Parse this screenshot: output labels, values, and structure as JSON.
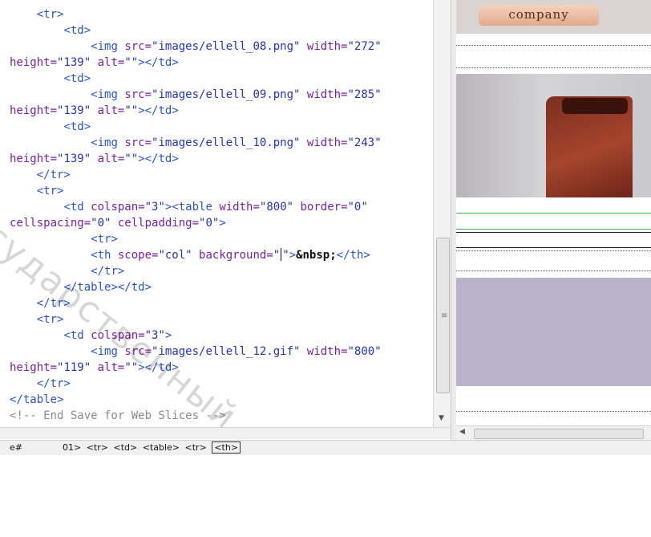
{
  "code_lines": [
    {
      "indent": "    ",
      "parts": [
        {
          "t": "<tr>",
          "c": "tag"
        }
      ]
    },
    {
      "indent": "        ",
      "parts": [
        {
          "t": "<td>",
          "c": "tag"
        }
      ]
    },
    {
      "indent": "            ",
      "parts": [
        {
          "t": "<img ",
          "c": "tag"
        },
        {
          "t": "src=",
          "c": "attr"
        },
        {
          "t": "\"images/ellell_08.png\"",
          "c": "str"
        },
        {
          "t": " width=",
          "c": "attr"
        },
        {
          "t": "\"272\"",
          "c": "str"
        }
      ]
    },
    {
      "indent": "",
      "parts": [
        {
          "t": "height=",
          "c": "attr"
        },
        {
          "t": "\"139\"",
          "c": "str"
        },
        {
          "t": " alt=",
          "c": "attr"
        },
        {
          "t": "\"\"",
          "c": "str"
        },
        {
          "t": "></td>",
          "c": "tag"
        }
      ]
    },
    {
      "indent": "        ",
      "parts": [
        {
          "t": "<td>",
          "c": "tag"
        }
      ]
    },
    {
      "indent": "            ",
      "parts": [
        {
          "t": "<img ",
          "c": "tag"
        },
        {
          "t": "src=",
          "c": "attr"
        },
        {
          "t": "\"images/ellell_09.png\"",
          "c": "str"
        },
        {
          "t": " width=",
          "c": "attr"
        },
        {
          "t": "\"285\"",
          "c": "str"
        }
      ]
    },
    {
      "indent": "",
      "parts": [
        {
          "t": "height=",
          "c": "attr"
        },
        {
          "t": "\"139\"",
          "c": "str"
        },
        {
          "t": " alt=",
          "c": "attr"
        },
        {
          "t": "\"\"",
          "c": "str"
        },
        {
          "t": "></td>",
          "c": "tag"
        }
      ]
    },
    {
      "indent": "        ",
      "parts": [
        {
          "t": "<td>",
          "c": "tag"
        }
      ]
    },
    {
      "indent": "            ",
      "parts": [
        {
          "t": "<img ",
          "c": "tag"
        },
        {
          "t": "src=",
          "c": "attr"
        },
        {
          "t": "\"images/ellell_10.png\"",
          "c": "str"
        },
        {
          "t": " width=",
          "c": "attr"
        },
        {
          "t": "\"243\"",
          "c": "str"
        }
      ]
    },
    {
      "indent": "",
      "parts": [
        {
          "t": "height=",
          "c": "attr"
        },
        {
          "t": "\"139\"",
          "c": "str"
        },
        {
          "t": " alt=",
          "c": "attr"
        },
        {
          "t": "\"\"",
          "c": "str"
        },
        {
          "t": "></td>",
          "c": "tag"
        }
      ]
    },
    {
      "indent": "    ",
      "parts": [
        {
          "t": "</tr>",
          "c": "tag"
        }
      ]
    },
    {
      "indent": "    ",
      "parts": [
        {
          "t": "<tr>",
          "c": "tag"
        }
      ]
    },
    {
      "indent": "        ",
      "parts": [
        {
          "t": "<td ",
          "c": "tag"
        },
        {
          "t": "colspan=",
          "c": "attr"
        },
        {
          "t": "\"3\"",
          "c": "str"
        },
        {
          "t": "><table ",
          "c": "tag"
        },
        {
          "t": "width=",
          "c": "attr"
        },
        {
          "t": "\"800\"",
          "c": "str"
        },
        {
          "t": " border=",
          "c": "attr"
        },
        {
          "t": "\"0\"",
          "c": "str"
        }
      ]
    },
    {
      "indent": "",
      "parts": [
        {
          "t": "cellspacing=",
          "c": "attr"
        },
        {
          "t": "\"0\"",
          "c": "str"
        },
        {
          "t": " cellpadding=",
          "c": "attr"
        },
        {
          "t": "\"0\"",
          "c": "str"
        },
        {
          "t": ">",
          "c": "tag"
        }
      ]
    },
    {
      "indent": "            ",
      "parts": [
        {
          "t": "<tr>",
          "c": "tag"
        }
      ]
    },
    {
      "indent": "            ",
      "parts": [
        {
          "t": "<th ",
          "c": "tag"
        },
        {
          "t": "scope=",
          "c": "attr"
        },
        {
          "t": "\"col\"",
          "c": "str"
        },
        {
          "t": " background=",
          "c": "attr"
        },
        {
          "t": "\"",
          "c": "str"
        },
        {
          "t": "",
          "c": "caret"
        },
        {
          "t": "\"",
          "c": "str"
        },
        {
          "t": ">",
          "c": "tag"
        },
        {
          "t": "&nbsp;",
          "c": "txt"
        },
        {
          "t": "</th>",
          "c": "tag"
        }
      ]
    },
    {
      "indent": "            ",
      "parts": [
        {
          "t": "</tr>",
          "c": "tag"
        }
      ]
    },
    {
      "indent": "        ",
      "parts": [
        {
          "t": "</table></td>",
          "c": "tag"
        }
      ]
    },
    {
      "indent": "    ",
      "parts": [
        {
          "t": "</tr>",
          "c": "tag"
        }
      ]
    },
    {
      "indent": "    ",
      "parts": [
        {
          "t": "<tr>",
          "c": "tag"
        }
      ]
    },
    {
      "indent": "        ",
      "parts": [
        {
          "t": "<td ",
          "c": "tag"
        },
        {
          "t": "colspan=",
          "c": "attr"
        },
        {
          "t": "\"3\"",
          "c": "str"
        },
        {
          "t": ">",
          "c": "tag"
        }
      ]
    },
    {
      "indent": "            ",
      "parts": [
        {
          "t": "<img ",
          "c": "tag"
        },
        {
          "t": "src=",
          "c": "attr"
        },
        {
          "t": "\"images/ellell_12.gif\"",
          "c": "str"
        },
        {
          "t": " width=",
          "c": "attr"
        },
        {
          "t": "\"800\"",
          "c": "str"
        }
      ]
    },
    {
      "indent": "",
      "parts": [
        {
          "t": "height=",
          "c": "attr"
        },
        {
          "t": "\"119\"",
          "c": "str"
        },
        {
          "t": " alt=",
          "c": "attr"
        },
        {
          "t": "\"\"",
          "c": "str"
        },
        {
          "t": "></td>",
          "c": "tag"
        }
      ]
    },
    {
      "indent": "    ",
      "parts": [
        {
          "t": "</tr>",
          "c": "tag"
        }
      ]
    },
    {
      "indent": "",
      "parts": [
        {
          "t": "</table>",
          "c": "tag"
        }
      ]
    },
    {
      "indent": "",
      "parts": [
        {
          "t": "<!-- End Save for Web Slices -->",
          "c": "cmt"
        }
      ]
    }
  ],
  "design_view": {
    "company_label": "company"
  },
  "status_bar": {
    "left_text": "e#",
    "tag_selector": [
      "01>",
      "<tr>",
      "<td>",
      "<table>",
      "<tr>"
    ],
    "selected_tag": "<th>"
  },
  "watermark": "государственный",
  "colors": {
    "tag": "#2b53c9",
    "attribute": "#7a1fa2",
    "string": "#2233bb",
    "comment": "#8a8a8a",
    "selection_outline": "#4caf50",
    "purple_region": "#bab2cd"
  }
}
